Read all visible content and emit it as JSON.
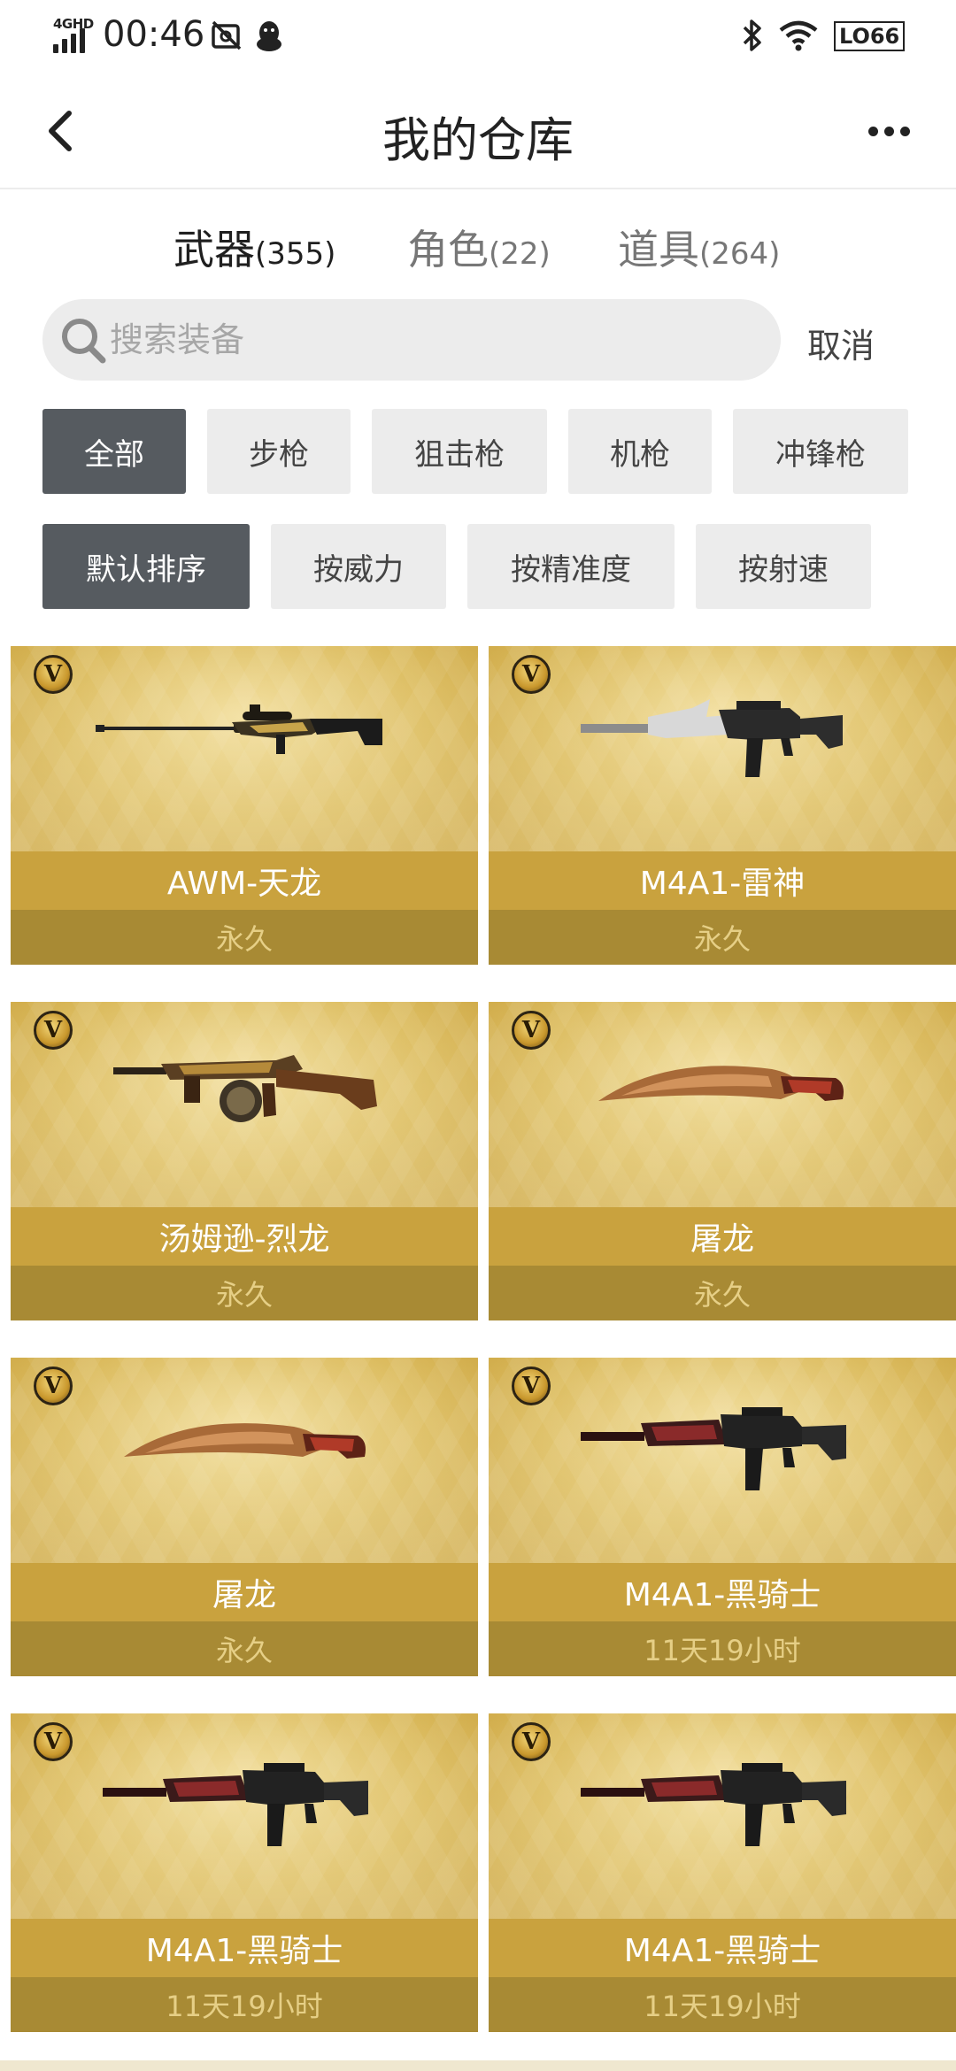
{
  "status_bar": {
    "network": "4GHD",
    "time": "00:46",
    "battery_label": "LO66"
  },
  "header": {
    "title": "我的仓库"
  },
  "tabs": [
    {
      "label": "武器",
      "count": "(355)",
      "active": true
    },
    {
      "label": "角色",
      "count": "(22)",
      "active": false
    },
    {
      "label": "道具",
      "count": "(264)",
      "active": false
    }
  ],
  "search": {
    "placeholder": "搜索装备",
    "value": "",
    "cancel_label": "取消"
  },
  "categories": [
    {
      "label": "全部",
      "active": true
    },
    {
      "label": "步枪",
      "active": false
    },
    {
      "label": "狙击枪",
      "active": false
    },
    {
      "label": "机枪",
      "active": false
    },
    {
      "label": "冲锋枪",
      "active": false
    }
  ],
  "sorts": [
    {
      "label": "默认排序",
      "active": true
    },
    {
      "label": "按威力",
      "active": false
    },
    {
      "label": "按精准度",
      "active": false
    },
    {
      "label": "按射速",
      "active": false
    }
  ],
  "items": [
    {
      "name": "AWM-天龙",
      "duration": "永久",
      "badge": "V",
      "icon": "sniper-rifle-icon"
    },
    {
      "name": "M4A1-雷神",
      "duration": "永久",
      "badge": "V",
      "icon": "assault-rifle-icon"
    },
    {
      "name": "汤姆逊-烈龙",
      "duration": "永久",
      "badge": "V",
      "icon": "submachine-gun-icon"
    },
    {
      "name": "屠龙",
      "duration": "永久",
      "badge": "V",
      "icon": "machete-icon"
    },
    {
      "name": "屠龙",
      "duration": "永久",
      "badge": "V",
      "icon": "machete-icon"
    },
    {
      "name": "M4A1-黑骑士",
      "duration": "11天19小时",
      "badge": "V",
      "icon": "assault-rifle-icon"
    },
    {
      "name": "M4A1-黑骑士",
      "duration": "11天19小时",
      "badge": "V",
      "icon": "assault-rifle-icon"
    },
    {
      "name": "M4A1-黑骑士",
      "duration": "11天19小时",
      "badge": "V",
      "icon": "assault-rifle-icon"
    }
  ],
  "colors": {
    "active_chip": "#565b60",
    "chip": "#ececec",
    "card_gold": "#dcbc5f",
    "name_bar": "#c9a23e",
    "duration_bar": "#a88a34"
  }
}
